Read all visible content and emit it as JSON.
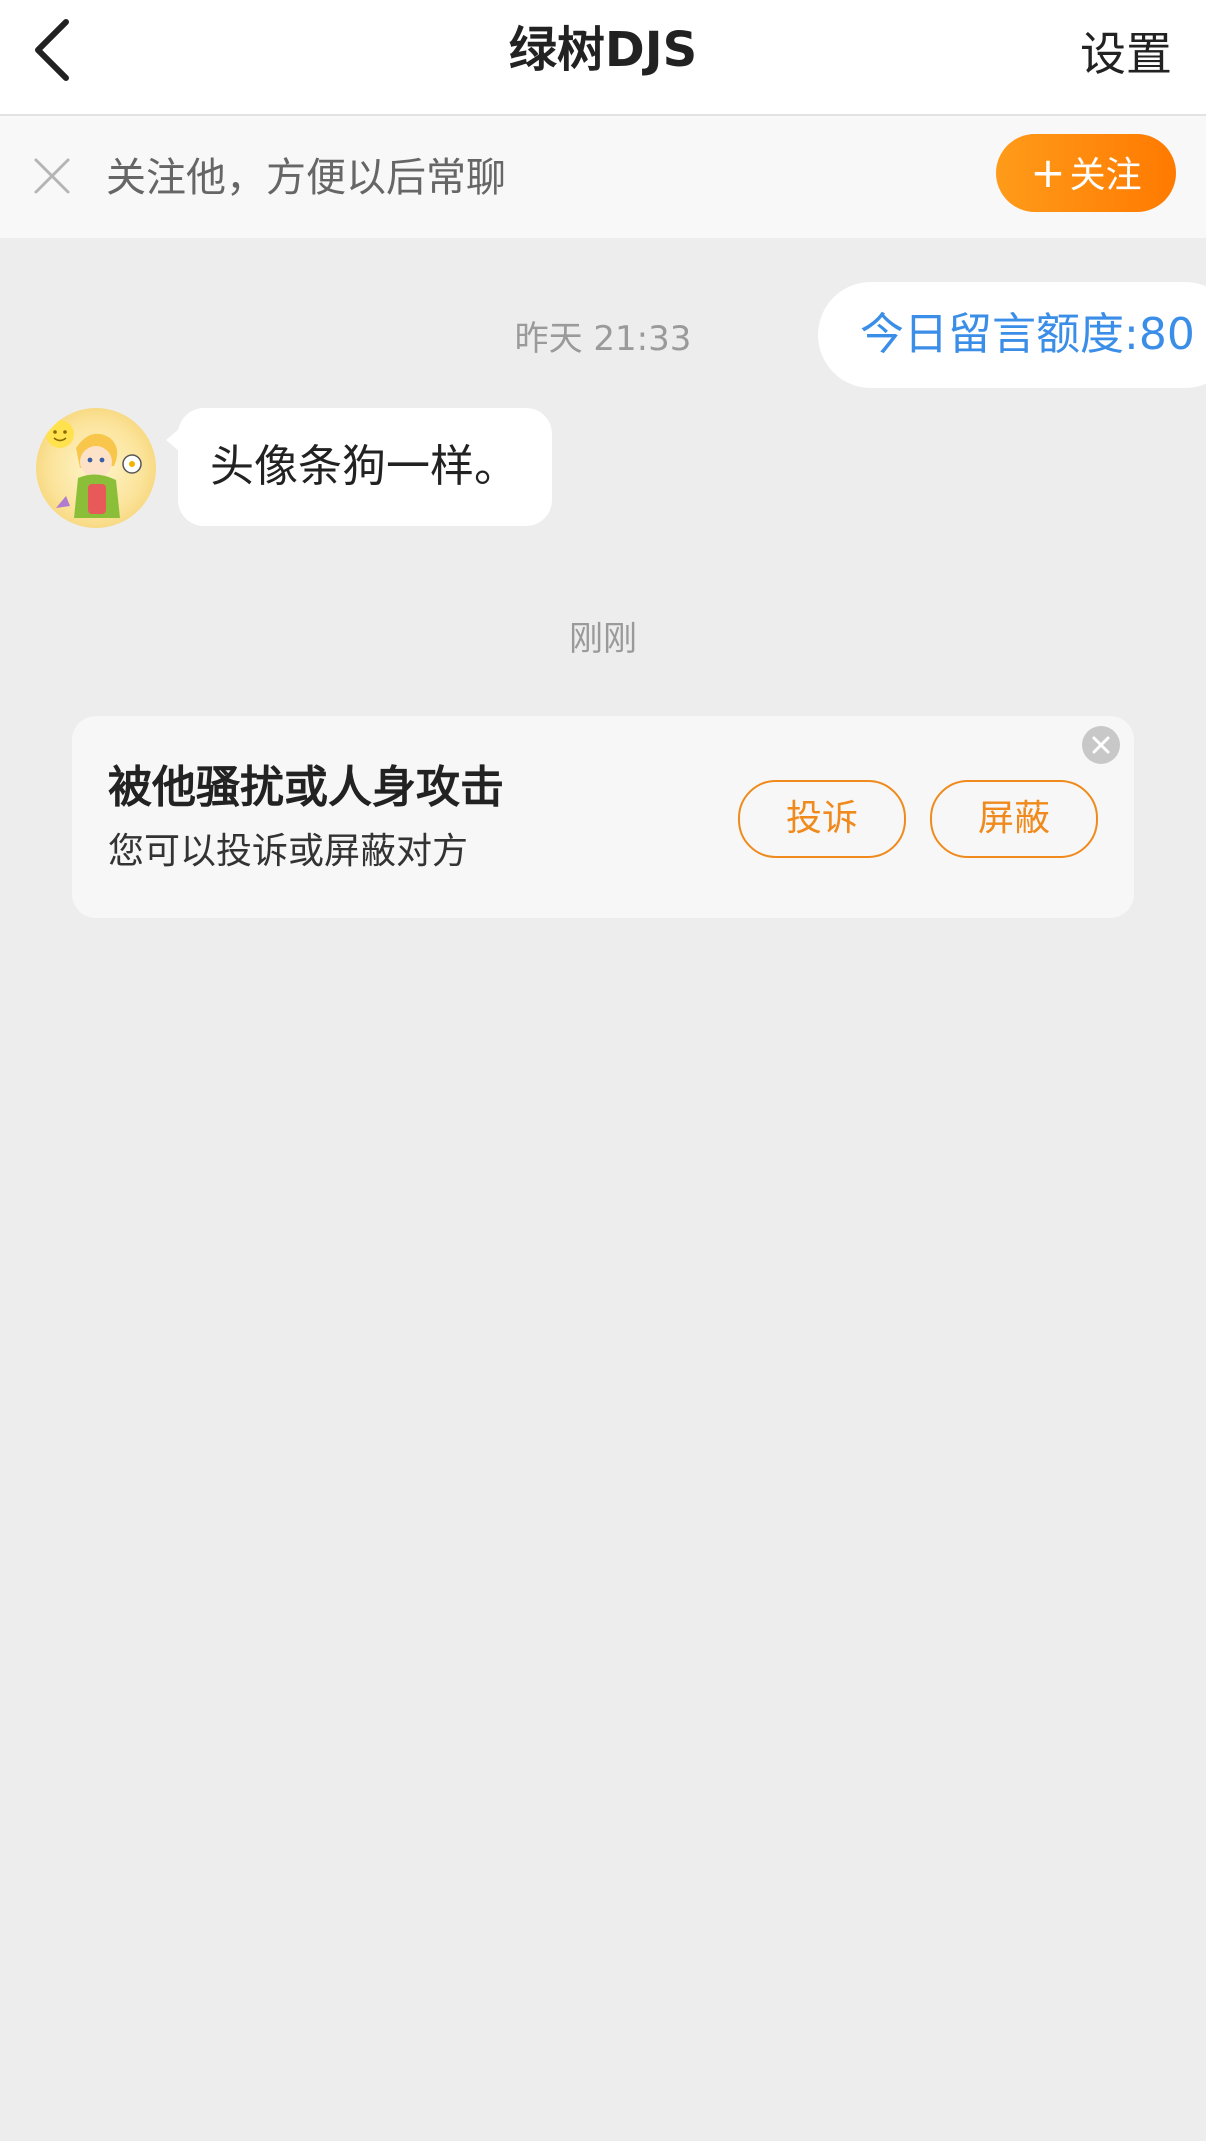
{
  "nav": {
    "back_icon": "chevron-left-icon",
    "title": "绿树DJS",
    "settings_label": "设置"
  },
  "follow_bar": {
    "close_icon": "close-icon",
    "prompt_text": "关注他，方便以后常聊",
    "follow_plus": "+",
    "follow_label": "关注",
    "button_color": "#ff8a00"
  },
  "chat": {
    "quota_text": "今日留言额度:80",
    "quota_color": "#3b8ee8",
    "messages": [
      {
        "timestamp": "昨天 21:33",
        "sender": "other",
        "avatar_icon": "avatar-illustration",
        "text": "头像条狗一样。"
      }
    ],
    "timestamp_now": "刚刚"
  },
  "report_card": {
    "title": "被他骚扰或人身攻击",
    "subtitle": "您可以投诉或屏蔽对方",
    "complain_label": "投诉",
    "block_label": "屏蔽",
    "close_icon": "close-circle-icon",
    "accent_color": "#f08a1c"
  }
}
